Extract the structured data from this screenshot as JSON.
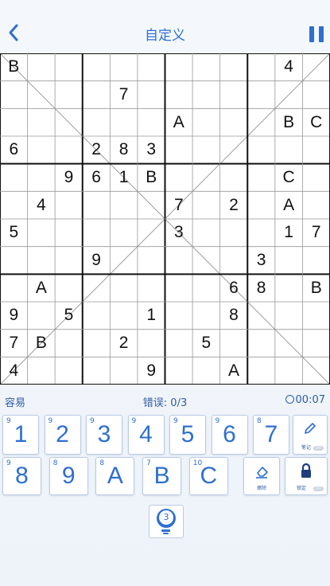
{
  "header": {
    "title": "自定义"
  },
  "board": {
    "rows": [
      [
        "B",
        "",
        "",
        "",
        "",
        "",
        "",
        "",
        "",
        "",
        "4",
        ""
      ],
      [
        "",
        "",
        "",
        "",
        "7",
        "",
        "",
        "",
        "",
        "",
        "",
        ""
      ],
      [
        "",
        "",
        "",
        "",
        "",
        "",
        "A",
        "",
        "",
        "",
        "B",
        "C"
      ],
      [
        "6",
        "",
        "",
        "2",
        "8",
        "3",
        "",
        "",
        "",
        "",
        "",
        ""
      ],
      [
        "",
        "",
        "9",
        "6",
        "1",
        "B",
        "",
        "",
        "",
        "",
        "C",
        ""
      ],
      [
        "",
        "4",
        "",
        "",
        "",
        "",
        "7",
        "",
        "2",
        "",
        "A",
        ""
      ],
      [
        "5",
        "",
        "",
        "",
        "",
        "",
        "3",
        "",
        "",
        "",
        "1",
        "7"
      ],
      [
        "",
        "",
        "",
        "9",
        "",
        "",
        "",
        "",
        "",
        "3",
        "",
        ""
      ],
      [
        "",
        "A",
        "",
        "",
        "",
        "",
        "",
        "",
        "6",
        "8",
        "",
        "B"
      ],
      [
        "9",
        "",
        "5",
        "",
        "",
        "1",
        "",
        "",
        "8",
        "",
        "",
        ""
      ],
      [
        "7",
        "B",
        "",
        "",
        "2",
        "",
        "",
        "5",
        "",
        "",
        "",
        ""
      ],
      [
        "4",
        "",
        "",
        "",
        "",
        "9",
        "",
        "",
        "A",
        "",
        "",
        ""
      ]
    ]
  },
  "status": {
    "difficulty": "容易",
    "errors": "错误: 0/3",
    "timer": "00:07"
  },
  "numpad": {
    "row1": [
      {
        "value": "1",
        "count": "9"
      },
      {
        "value": "2",
        "count": "9"
      },
      {
        "value": "3",
        "count": "9"
      },
      {
        "value": "4",
        "count": "9"
      },
      {
        "value": "5",
        "count": "9"
      },
      {
        "value": "6",
        "count": "9"
      },
      {
        "value": "7",
        "count": "8"
      }
    ],
    "row2": [
      {
        "value": "8",
        "count": "9"
      },
      {
        "value": "9",
        "count": "8"
      },
      {
        "value": "A",
        "count": "8"
      },
      {
        "value": "B",
        "count": "7"
      },
      {
        "value": "C",
        "count": "10"
      }
    ]
  },
  "tools": {
    "notes": {
      "label": "笔记",
      "state": "OFF"
    },
    "erase": {
      "label": "擦除"
    },
    "lock": {
      "label": "锁定",
      "state": "OFF"
    }
  },
  "hint": {
    "count": "3"
  },
  "colors": {
    "accent": "#2e6fd1",
    "grid": "#111111",
    "key_border": "#b9cbe5"
  }
}
